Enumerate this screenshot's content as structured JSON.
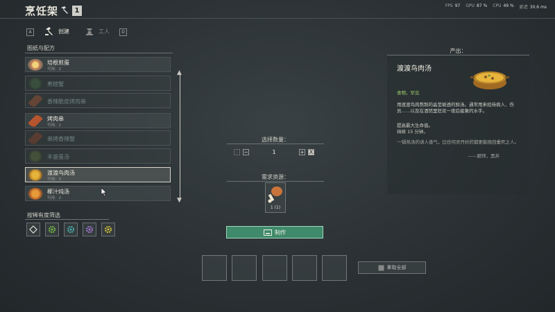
{
  "header": {
    "title": "烹饪架",
    "key_hint": "1"
  },
  "stats": {
    "fps_label": "FPS",
    "fps": "97",
    "gpu_label": "GPU",
    "gpu": "87 %",
    "cpu_label": "CPU",
    "cpu": "49 %",
    "latency_label": "延迟",
    "latency": "30.6 ms"
  },
  "tabs": {
    "a_key": "A",
    "build": "创建",
    "craft": "工人",
    "d_key": "D"
  },
  "recipes": {
    "header": "图纸与配方",
    "items": [
      {
        "name": "培根煎蛋",
        "sub": "可用：2"
      },
      {
        "name": "煮螃蟹",
        "sub": ""
      },
      {
        "name": "香辣脆皮烤肉串",
        "sub": ""
      },
      {
        "name": "烤肉串",
        "sub": "可用：2"
      },
      {
        "name": "串烤香辣蟹",
        "sub": ""
      },
      {
        "name": "丰盛蛋汤",
        "sub": ""
      },
      {
        "name": "渡渡鸟肉汤",
        "sub": "可用：3"
      },
      {
        "name": "椰汁炖汤",
        "sub": "可用：2"
      }
    ]
  },
  "filter": {
    "label": "按稀有度筛选"
  },
  "quantity": {
    "header": "选择数量：",
    "value": "1",
    "minus": "−",
    "plus": "+",
    "min": "-",
    "max": "X"
  },
  "resources": {
    "header": "需求资源：",
    "count": "1  (1)"
  },
  "make_button": {
    "label": "制作"
  },
  "take_all": {
    "label": "拿取全部"
  },
  "output": {
    "header": "产出：",
    "name": "渡渡鸟肉汤",
    "category": "食物，罕见",
    "description": "用渡渡鸟肉熬制的晶莹剔透的鲜汤。通常用来招待病人、伤员……以及在酒馆里狂欢一夜后疲惫的水手。",
    "effect1": "提高最大生命值。",
    "effect2": "持续 15 分钟。",
    "quote": "一锅热汤的诱人香气，比任何灵丹妙药都更能挽回垂死之人。",
    "author": "——厨师，黑井"
  },
  "colors": {
    "accent_green": "#3f8a6a",
    "category_green": "#9fcf6a"
  }
}
